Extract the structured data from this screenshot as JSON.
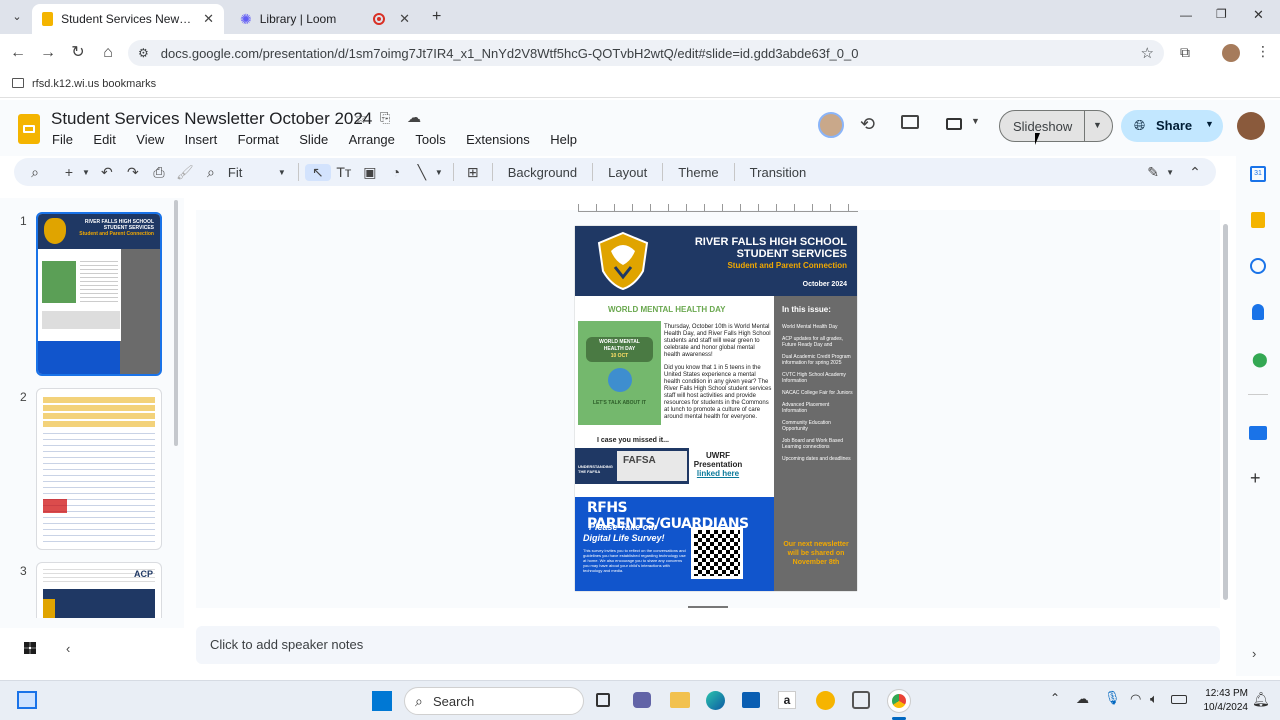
{
  "browser": {
    "tabs": [
      {
        "label": "Student Services Newsletter Oc",
        "active": true
      },
      {
        "label": "Library | Loom",
        "active": false
      }
    ],
    "url": "docs.google.com/presentation/d/1sm7oimg7Jt7IR4_x1_NnYd2V8Wtf5hcG-QOTvbH2wtQ/edit#slide=id.gdd3abde63f_0_0",
    "bookmarks_label": "rfsd.k12.wi.us bookmarks"
  },
  "app": {
    "title": "Student Services Newsletter October 2024",
    "menu": [
      "File",
      "Edit",
      "View",
      "Insert",
      "Format",
      "Slide",
      "Arrange",
      "Tools",
      "Extensions",
      "Help"
    ],
    "slideshow_label": "Slideshow",
    "share_label": "Share"
  },
  "toolbar": {
    "zoom": "Fit",
    "buttons": [
      "Background",
      "Layout",
      "Theme",
      "Transition"
    ]
  },
  "filmstrip": {
    "numbers": [
      "1",
      "2",
      "3"
    ],
    "thumb1": {
      "line1": "RIVER FALLS HIGH SCHOOL",
      "line2": "STUDENT SERVICES",
      "line3": "Student and Parent Connection"
    },
    "thumb2": {
      "acp": "ACP"
    }
  },
  "slide": {
    "school": "RIVER FALLS HIGH SCHOOL",
    "dept": "STUDENT SERVICES",
    "subtitle": "Student and Parent Connection",
    "date": "October  2024",
    "feature_title": "WORLD MENTAL HEALTH DAY",
    "badge_top": "WORLD MENTAL",
    "badge_mid": "HEALTH DAY",
    "badge_date": "10 OCT",
    "badge_bottom": "LET'S TALK ABOUT IT",
    "para1": "Thursday, October 10th is World Mental Health Day, and River Falls High School students and staff will wear green to celebrate and honor global mental health awareness!",
    "para2": "Did you know that 1 in 5 teens in the United States experience a mental health condition in any given year? The River Falls High School student services staff will host activities and provide resources for students in the Commons at lunch to promote a culture of care around mental health for everyone.",
    "missed": "I case you missed it...",
    "fafsa_label": "UNDERSTANDING THE FAFSA",
    "fafsa_img": "FAFSA",
    "uwrf1": "UWRF",
    "uwrf2": "Presentation",
    "uwrf3": "linked here",
    "parents": "RFHS PARENTS/GUARDIANS",
    "survey1": "Please Take our",
    "survey2": "Digital Life Survey!",
    "survey_text": "This survey invites you to reflect on the conversations and guidelines you have established regarding technology use at home. We also encourage you to share any concerns you may have about your child's interactions with technology and media.",
    "issue_title": "In this issue:",
    "issue_items": [
      "World Mental Health Day",
      "ACP updates for all grades, Future Ready Day and",
      "Dual Academic Credit Program information for spring 2025",
      "CVTC High School Academy Information",
      "NACAC College Fair for Juniors",
      "Advanced Placement Information",
      "Community Education Opportunity",
      "Job Board and Work Based Learning connections",
      "Upcoming dates and deadlines"
    ],
    "next_issue": "Our next newsletter will be shared on November 8th"
  },
  "notes_placeholder": "Click to add speaker notes",
  "taskbar": {
    "search": "Search",
    "time": "12:43 PM",
    "date": "10/4/2024"
  },
  "colors": {
    "navy": "#1f3864",
    "gold": "#f2a900",
    "green_title": "#6aa84f",
    "gray_panel": "#6b6b6b",
    "blue_banner": "#1155cc",
    "accent": "#1a73e8"
  }
}
